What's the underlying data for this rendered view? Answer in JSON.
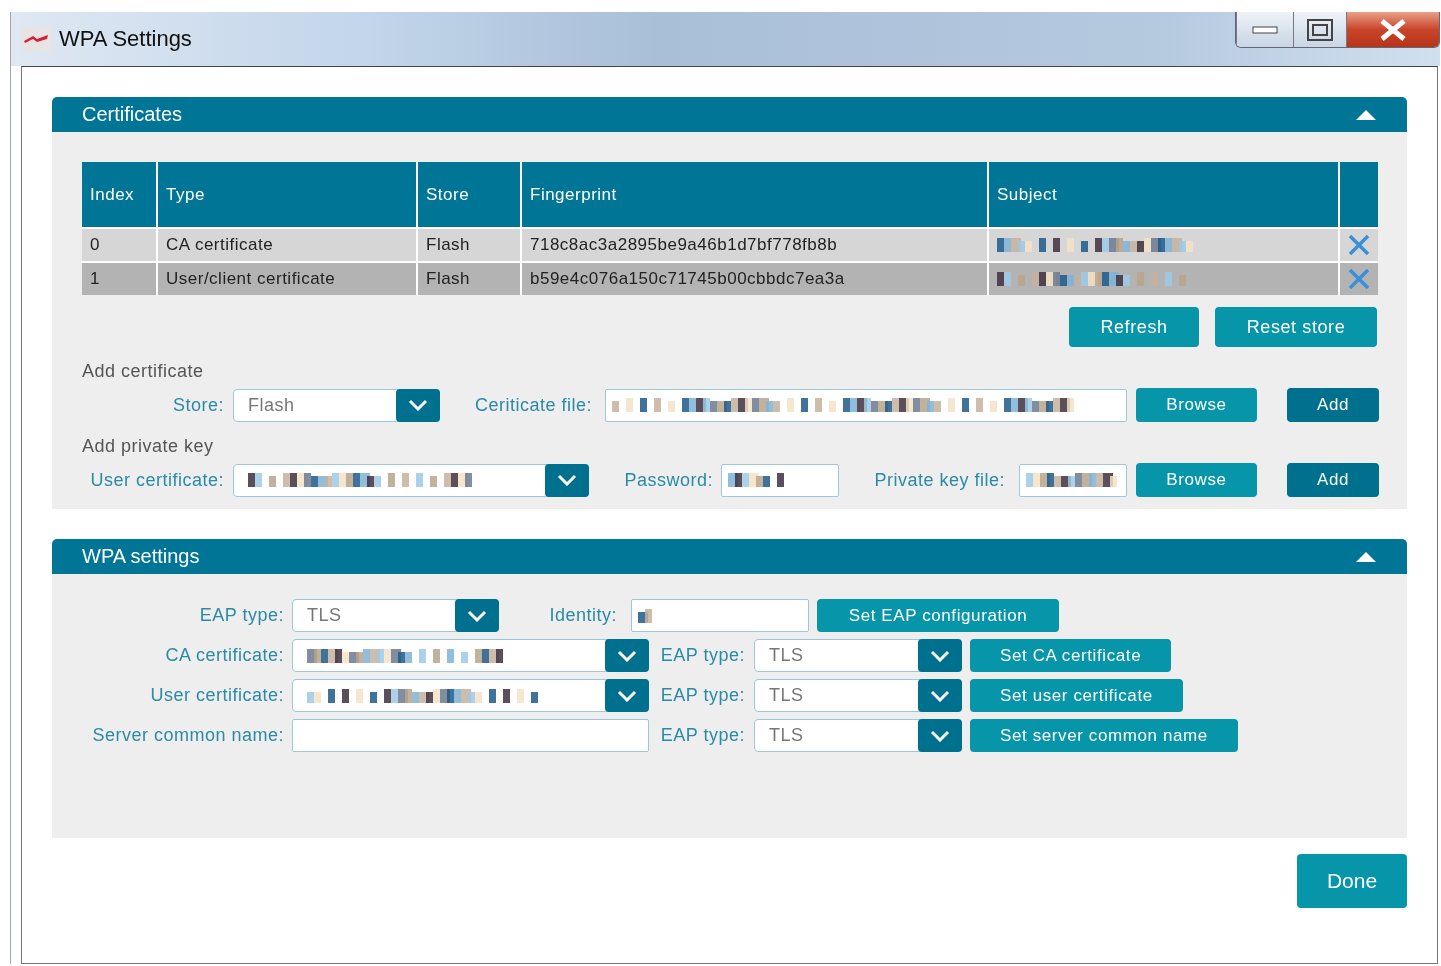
{
  "window": {
    "title": "WPA Settings"
  },
  "certificates": {
    "title": "Certificates",
    "expanded": true,
    "table": {
      "columns": [
        "Index",
        "Type",
        "Store",
        "Fingerprint",
        "Subject"
      ],
      "rows": [
        {
          "index": "0",
          "type": "CA certificate",
          "store": "Flash",
          "fingerprint": "718c8ac3a2895be9a46b1d7bf778fb8b",
          "selected": false
        },
        {
          "index": "1",
          "type": "User/client certificate",
          "store": "Flash",
          "fingerprint": "b59e4c076a150c71745b00cbbdc7ea3a",
          "selected": true
        }
      ]
    },
    "buttons": [
      "Refresh",
      "Reset store"
    ],
    "add_certificate": {
      "heading": "Add certificate",
      "store_label": "Store:",
      "store_value": "Flash",
      "file_label": "Ceriticate file:",
      "browse": "Browse",
      "add": "Add"
    },
    "add_private_key": {
      "heading": "Add private key",
      "user_certificate_label": "User certificate:",
      "password_label": "Password:",
      "key_file_label": "Private key file:",
      "browse": "Browse",
      "add": "Add"
    }
  },
  "wpa_settings": {
    "title": "WPA settings",
    "expanded": true,
    "eap_type": {
      "label": "EAP type:",
      "value": "TLS"
    },
    "identity_label": "Identity:",
    "set_eap_button": "Set EAP configuration",
    "rows": [
      {
        "kind": "select",
        "label": "CA certificate:",
        "eap_label": "EAP type:",
        "eap_value": "TLS",
        "button": "Set CA certificate"
      },
      {
        "kind": "select",
        "label": "User certificate:",
        "eap_label": "EAP type:",
        "eap_value": "TLS",
        "button": "Set user certificate"
      },
      {
        "kind": "input",
        "label": "Server common name:",
        "eap_label": "EAP type:",
        "eap_value": "TLS",
        "button": "Set server common name"
      }
    ]
  },
  "done_button": "Done"
}
